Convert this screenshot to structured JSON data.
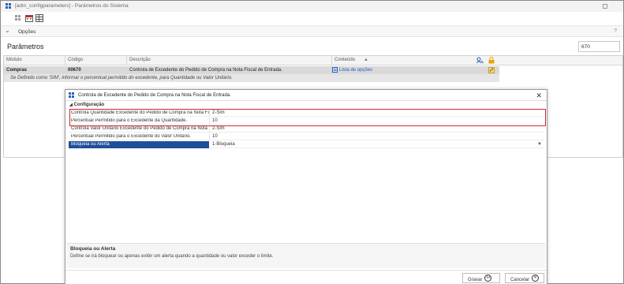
{
  "window": {
    "title": "[adm_configparameters] - Parâmetros do Sistema"
  },
  "toolbar": {
    "options_label": "Opções",
    "help_label": "?"
  },
  "main": {
    "title": "Parâmetros",
    "code_filter": "670",
    "grid": {
      "columns": [
        "Módulo",
        "Código",
        "Descrição",
        "Conteúdo"
      ],
      "row": {
        "module": "Compras",
        "code": "00670",
        "description": "Controla de Excedente do Pedido de Compra na Nota Fiscal de Entrada.",
        "content_link": "Lista de opções",
        "detail": "Se Definido como 'SIM', informar o percentual permitido do excedente, para Quantidade ou Valor Unitário."
      }
    }
  },
  "dialog": {
    "title": "Controla de Excedente do Pedido de Compra na Nota Fiscal de Entrada.",
    "section": "Configuração",
    "properties": [
      {
        "label": "Controla Quantidade Excedente do Pedido de Compra na Nota Fiscal",
        "value": "2-Sim"
      },
      {
        "label": "Percentual Permitido para o Excedente da Quantidade.",
        "value": "10"
      },
      {
        "label": "Controla Valor Unitário Excedente do Pedido de Compra na Nota Fiscal",
        "value": "2-Sim"
      },
      {
        "label": "Percentual Permitido para o Excedente do Valor Unitário.",
        "value": "10"
      },
      {
        "label": "Bloqueia ou Alerta",
        "value": "1-Bloqueia"
      }
    ],
    "description_title": "Bloqueia ou Alerta",
    "description_text": "Define se irá bloquear ou apenas exibir um alerta quando a quantidade ou valor exceder o limite.",
    "save_label": "Gravar",
    "cancel_label": "Cancelar"
  },
  "colors": {
    "selection": "#1f4e9a",
    "highlight_border": "#d9252b",
    "link": "#2a57c6"
  }
}
